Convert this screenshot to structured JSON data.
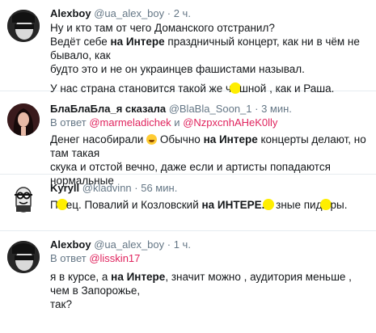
{
  "tweets": [
    {
      "name": "Alexboy",
      "handle": "@ua_alex_boy",
      "time": "· 2 ч.",
      "lines": [
        {
          "text": "Ну и кто там от чего Доманского отстранил?"
        },
        {
          "pre": "Ведёт себе ",
          "bold": "на Интере",
          "post": " праздничный концерт, как ни в чём не бывало, как"
        },
        {
          "text": "будто это и не он украинцев фашистами называл."
        },
        {
          "pre": "У нас страна становится такой же ч",
          "post": "шной , как и Раша."
        }
      ]
    },
    {
      "name": "БлаБлаБла_я сказала",
      "handle": "@BlaBla_Soon_1",
      "time": "· 3 мин.",
      "reply_prefix": "В ответ",
      "reply_to_1": "@marmeladichek",
      "reply_and": "и",
      "reply_to_2": "@NzpxcnhAHeK0lly",
      "lines": [
        {
          "pre": "Денег насобирали ",
          "post": " Обычно ",
          "bold": "на Интере",
          "post2": " концерты делают, но там такая"
        },
        {
          "text": "скука и отстой вечно, даже если и артисты попадаются нормальные"
        }
      ]
    },
    {
      "name": "Kyryll",
      "handle": "@kladvinn",
      "time": "· 56 мин.",
      "lines": [
        {
          "pre": "П",
          "mid": "ец. Повалий и Козловский ",
          "bold": "на ИНТЕРЕ.",
          "post": "  зные пид",
          "post2": "ры."
        }
      ]
    },
    {
      "name": "Alexboy",
      "handle": "@ua_alex_boy",
      "time": "· 1 ч.",
      "reply_prefix": "В ответ",
      "reply_to_1": "@lisskin17",
      "lines": [
        {
          "pre": "я в курсе, а ",
          "bold": "на Интере",
          "post": ", значит можно , аудитория меньше , чем в Запорожье,"
        },
        {
          "text": "так?"
        }
      ]
    }
  ],
  "colors": {
    "link": "#e0245e",
    "muted": "#657786",
    "censor": "#ffee00",
    "divider": "#e6ecf0"
  }
}
